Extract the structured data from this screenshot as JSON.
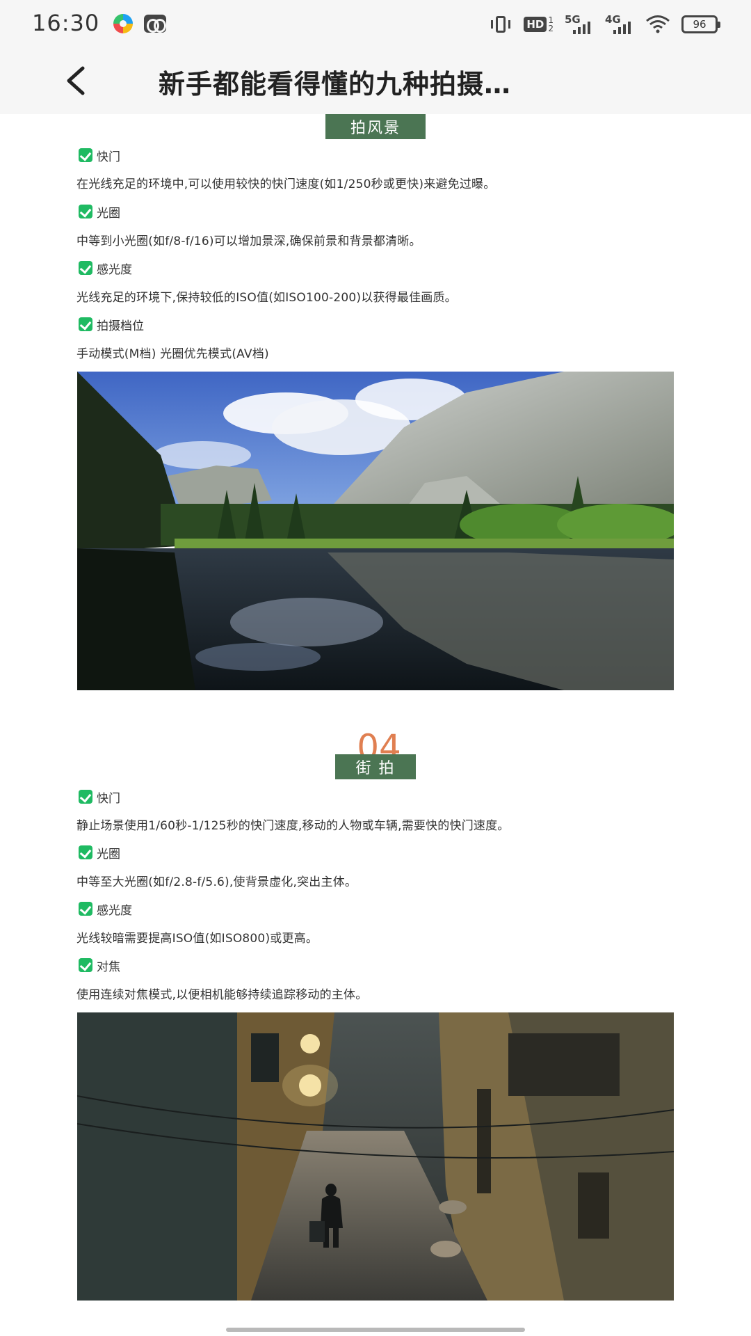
{
  "status_bar": {
    "time": "16:30",
    "hd_label": "HD",
    "hd_sub_top": "1",
    "hd_sub_bottom": "2",
    "network1": "5G",
    "network2": "4G",
    "battery": "96"
  },
  "header": {
    "title": "新手都能看得懂的九种拍摄…"
  },
  "sections": [
    {
      "title": "拍风景",
      "items": [
        {
          "label": "快门",
          "desc": "在光线充足的环境中,可以使用较快的快门速度(如1/250秒或更快)来避免过曝。"
        },
        {
          "label": "光圈",
          "desc": "中等到小光圈(如f/8-f/16)可以增加景深,确保前景和背景都清晰。"
        },
        {
          "label": "感光度",
          "desc": "光线充足的环境下,保持较低的ISO值(如ISO100-200)以获得最佳画质。"
        },
        {
          "label": "拍摄档位",
          "desc": "手动模式(M档) 光圈优先模式(AV档)"
        }
      ]
    },
    {
      "number": "04",
      "title": "街 拍",
      "items": [
        {
          "label": "快门",
          "desc": "静止场景使用1/60秒-1/125秒的快门速度,移动的人物或车辆,需要快的快门速度。"
        },
        {
          "label": "光圈",
          "desc": "中等至大光圈(如f/2.8-f/5.6),使背景虚化,突出主体。"
        },
        {
          "label": "感光度",
          "desc": "光线较暗需要提高ISO值(如ISO800)或更高。"
        },
        {
          "label": "对焦",
          "desc": "使用连续对焦模式,以便相机能够持续追踪移动的主体。"
        }
      ]
    }
  ],
  "colors": {
    "badge_bg": "#4b7553",
    "check_green": "#1fba62",
    "number_orange": "#e07f51"
  }
}
